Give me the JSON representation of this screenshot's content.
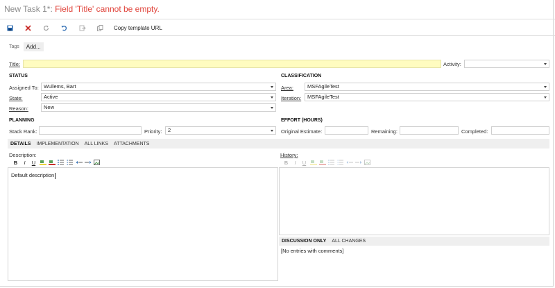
{
  "window": {
    "title": "New Task 1*:",
    "error": "Field 'Title' cannot be empty."
  },
  "toolbar": {
    "icons": [
      "save-icon",
      "close-icon",
      "refresh-icon",
      "undo-icon",
      "link-icon",
      "copy-icon"
    ],
    "copy_template_label": "Copy template URL"
  },
  "tags": {
    "label": "Tags",
    "add_label": "Add..."
  },
  "title_field": {
    "label": "Title:",
    "value": ""
  },
  "activity": {
    "label": "Activity:",
    "value": ""
  },
  "status": {
    "heading": "STATUS",
    "assigned_to": {
      "label": "Assigned To:",
      "value": "Wullems, Bart"
    },
    "state": {
      "label": "State:",
      "value": "Active"
    },
    "reason": {
      "label": "Reason:",
      "value": "New"
    }
  },
  "classification": {
    "heading": "CLASSIFICATION",
    "area": {
      "label": "Area:",
      "value": "MSFAgileTest"
    },
    "iteration": {
      "label": "Iteration:",
      "value": "MSFAgileTest"
    }
  },
  "planning": {
    "heading": "PLANNING",
    "stack_rank": {
      "label": "Stack Rank:",
      "value": ""
    },
    "priority": {
      "label": "Priority:",
      "value": "2"
    }
  },
  "effort": {
    "heading": "EFFORT (HOURS)",
    "original_estimate": {
      "label": "Original Estimate:",
      "value": ""
    },
    "remaining": {
      "label": "Remaining:",
      "value": ""
    },
    "completed": {
      "label": "Completed:",
      "value": ""
    }
  },
  "tabs": [
    "DETAILS",
    "IMPLEMENTATION",
    "ALL LINKS",
    "ATTACHMENTS"
  ],
  "description": {
    "label": "Description:",
    "value": "Default description",
    "format_buttons": [
      "B",
      "I",
      "U"
    ]
  },
  "history": {
    "label": "History:",
    "format_buttons": [
      "B",
      "I",
      "U"
    ]
  },
  "discussion": {
    "tabs": [
      "DISCUSSION ONLY",
      "ALL CHANGES"
    ],
    "empty_text": "[No entries with comments]"
  },
  "colors": {
    "error_text": "#e0433a",
    "title_error_bg": "#fffcc0",
    "save_icon": "#1e5fa8",
    "close_icon": "#c9302c"
  }
}
